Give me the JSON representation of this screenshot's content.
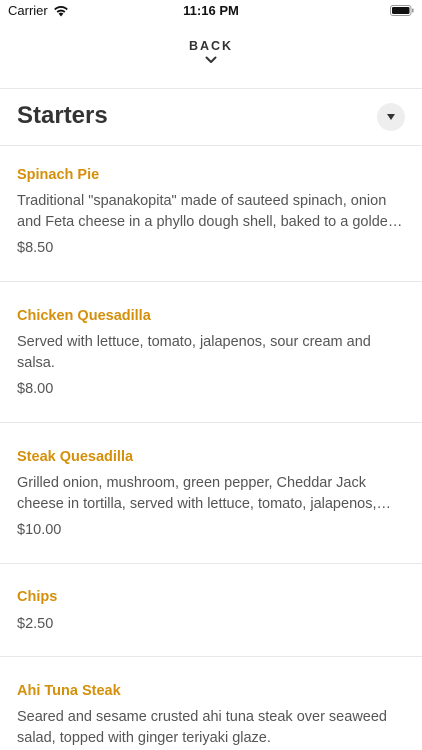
{
  "status_bar": {
    "carrier": "Carrier",
    "time": "11:16 PM"
  },
  "header": {
    "back_label": "BACK"
  },
  "section": {
    "title": "Starters"
  },
  "items": [
    {
      "name": "Spinach Pie",
      "description": "Traditional \"spanakopita\" made of sauteed spinach, onion and Feta cheese in a phyllo dough shell, baked to a golden brown.",
      "price": "$8.50"
    },
    {
      "name": "Chicken Quesadilla",
      "description": "Served with lettuce, tomato, jalapenos, sour cream and salsa.",
      "price": "$8.00"
    },
    {
      "name": "Steak Quesadilla",
      "description": "Grilled onion, mushroom, green pepper, Cheddar Jack cheese in tortilla, served with lettuce, tomato, jalapenos, sour cream and salsa.",
      "price": "$10.00"
    },
    {
      "name": "Chips",
      "price": "$2.50"
    },
    {
      "name": "Ahi Tuna Steak",
      "description": "Seared and sesame crusted ahi tuna steak over seaweed salad, topped with ginger teriyaki glaze."
    }
  ],
  "colors": {
    "item_name": "#d4900a",
    "text": "#333333",
    "muted_text": "#555555",
    "divider": "#e8e8e8"
  }
}
